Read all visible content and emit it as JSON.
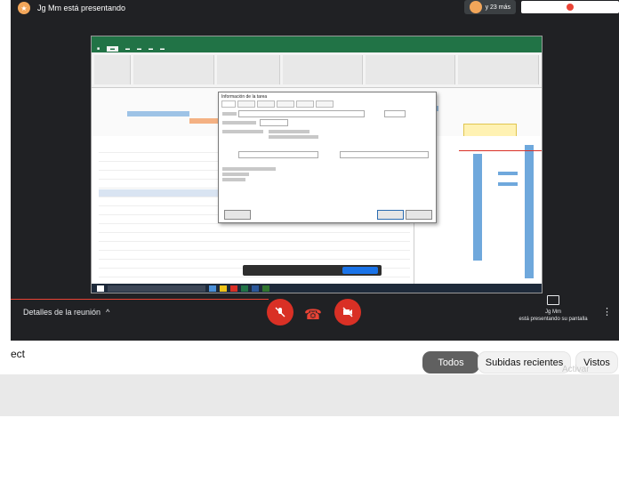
{
  "meet": {
    "presenter_label": "Jg Mm está presentando",
    "participants_label": "y 23 más",
    "details_label": "Detalles de la reunión",
    "present_name": "Jg Mm",
    "present_subtitle": "está presentando su pantalla",
    "colors": {
      "background": "#202124",
      "danger": "#d93025",
      "accent": "#1a73e8"
    }
  },
  "shared_screen": {
    "app": "Microsoft Project",
    "dialog_title": "Información de la tarea"
  },
  "filters": {
    "partial_text": "ect",
    "chips": [
      "Todos",
      "Subidas recientes",
      "Vistos"
    ],
    "watermark": "Activar"
  },
  "icons": {
    "details_chevron": "^",
    "mic": "mic-off-icon",
    "camera": "camera-off-icon",
    "hangup": "phone-hangup-icon",
    "present": "present-screen-icon",
    "more": "more-vert-icon"
  }
}
